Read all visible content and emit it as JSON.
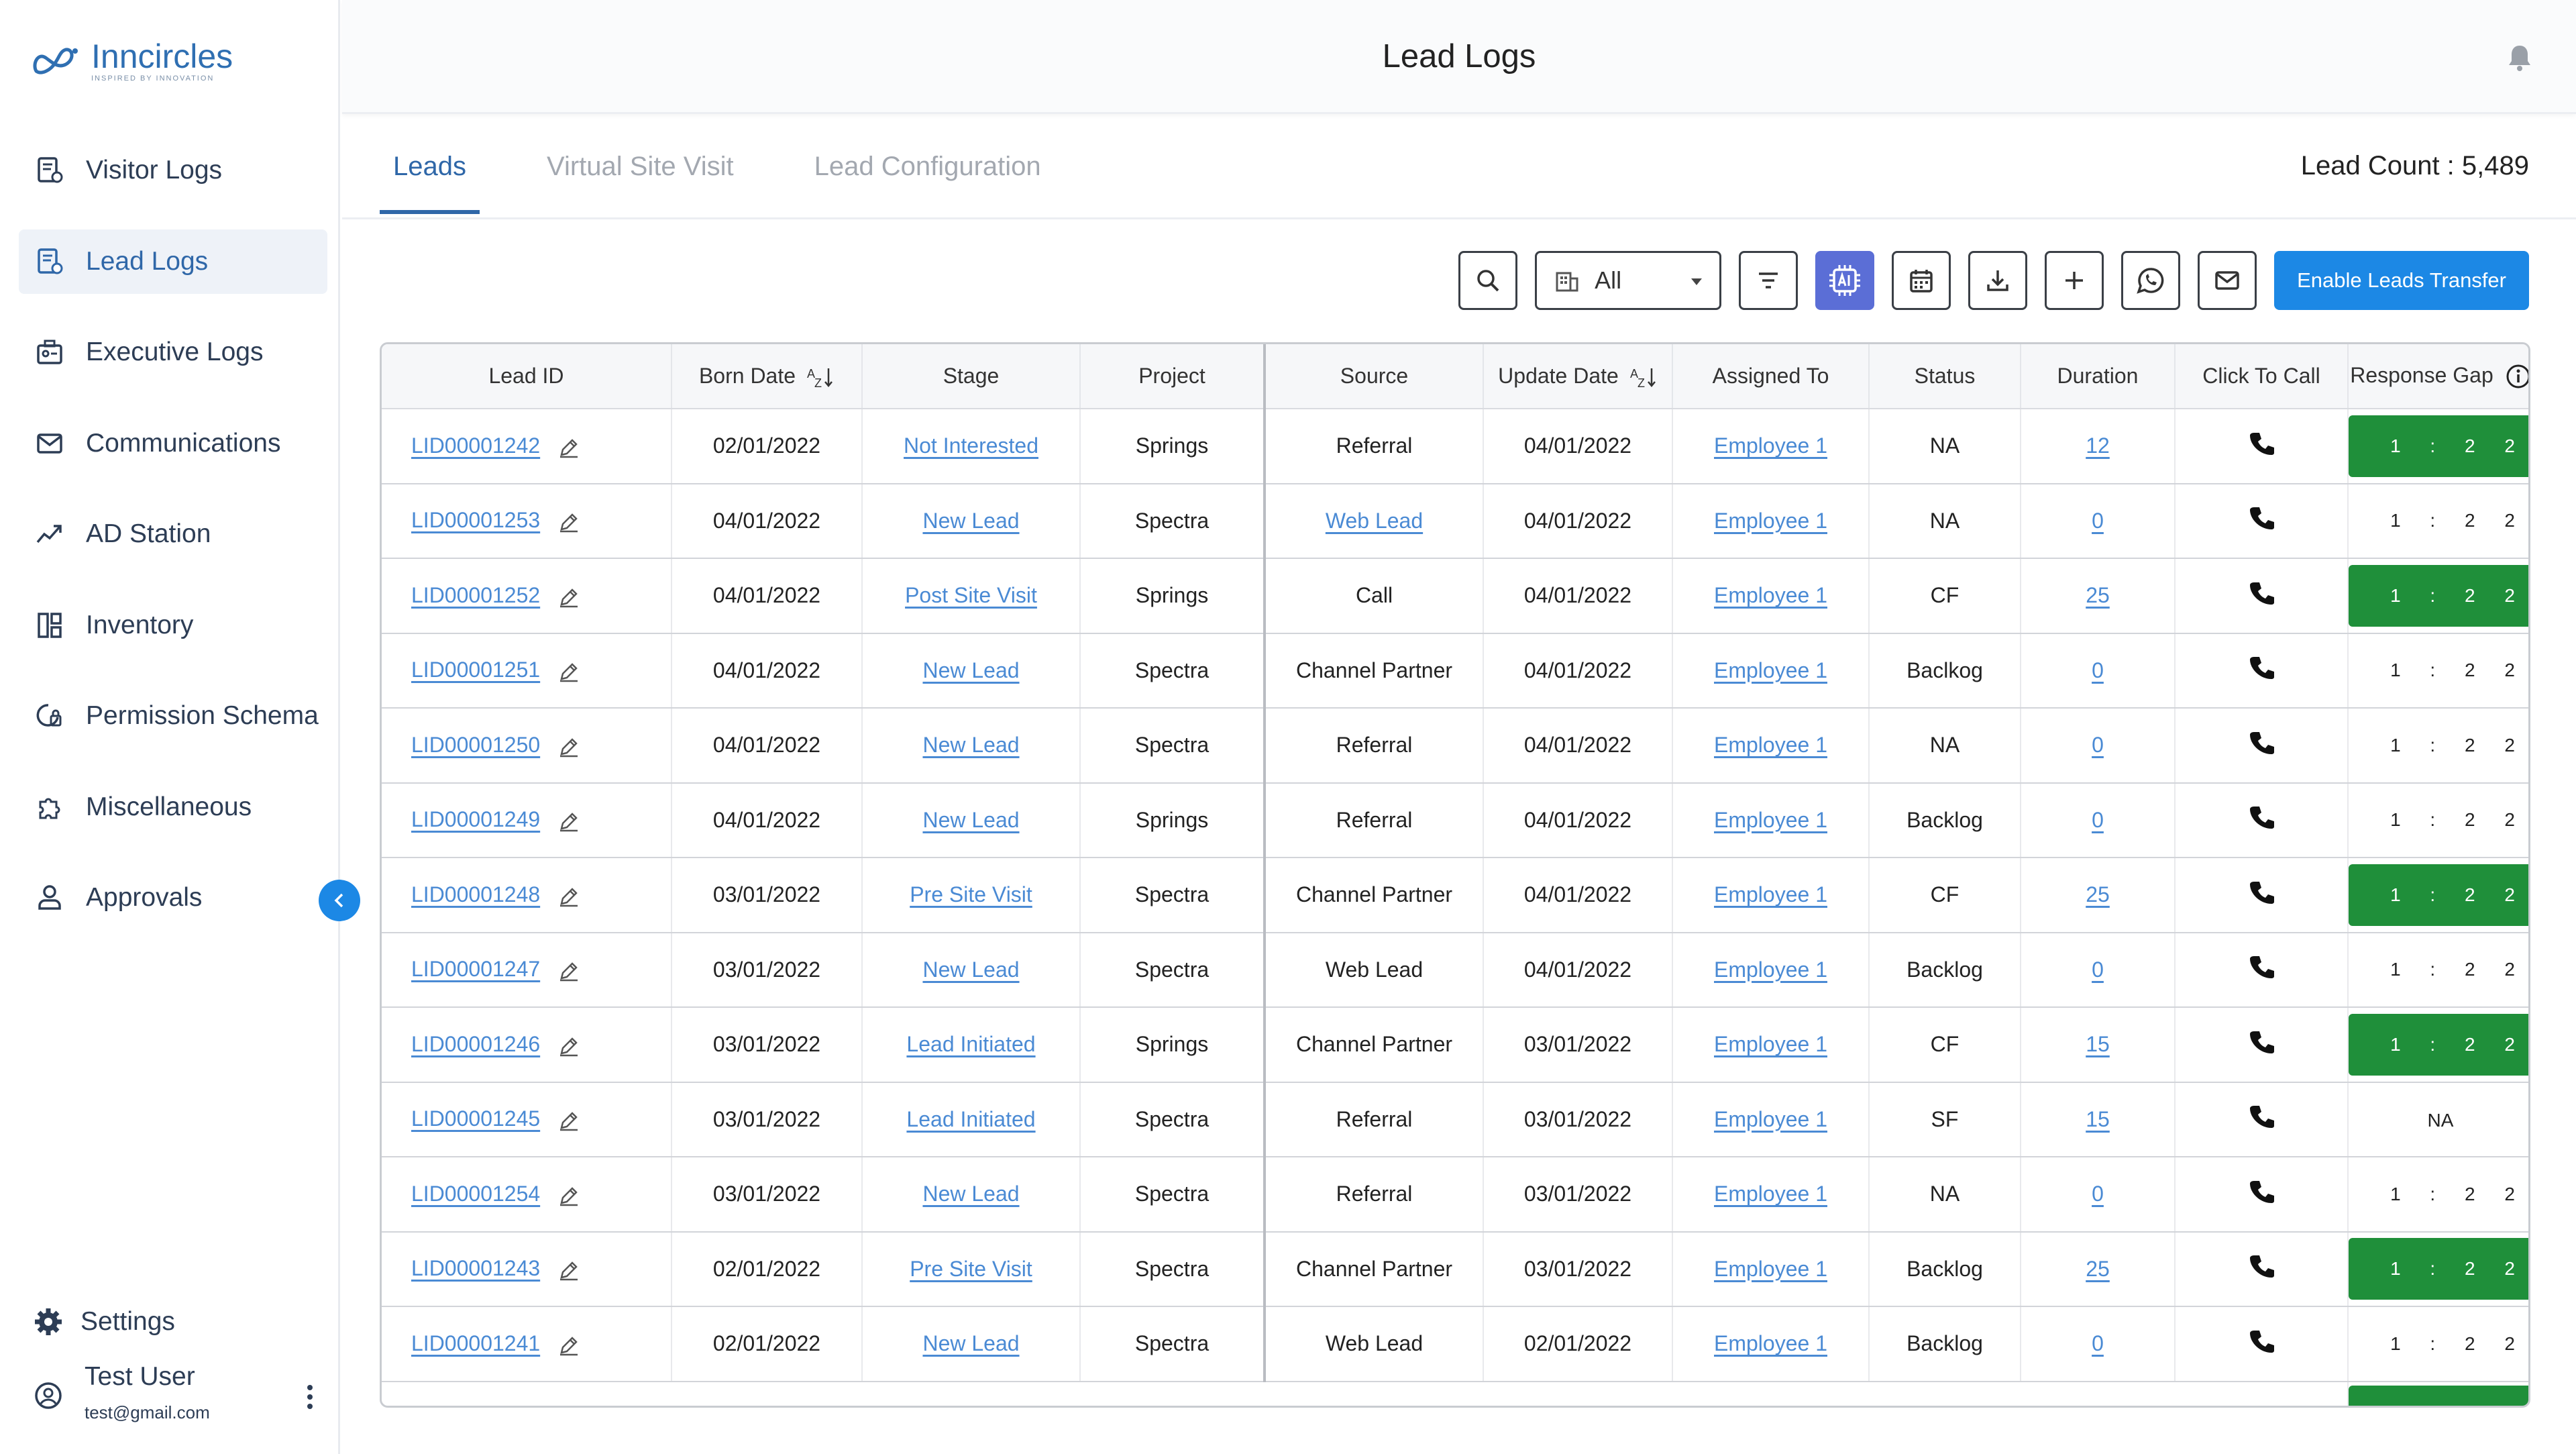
{
  "brand": {
    "name": "Inncircles",
    "tagline": "INSPIRED BY INNOVATION",
    "accent": "#2f67a8",
    "primary_button": "#1c88e5",
    "badge_green": "#1f8f3a"
  },
  "header": {
    "title": "Lead Logs",
    "bell_icon": "bell-icon"
  },
  "sidebar": {
    "items": [
      {
        "label": "Visitor Logs",
        "icon": "visitor-logs-icon"
      },
      {
        "label": "Lead Logs",
        "icon": "lead-logs-icon",
        "active": true
      },
      {
        "label": "Executive Logs",
        "icon": "executive-logs-icon"
      },
      {
        "label": "Communications",
        "icon": "mail-icon"
      },
      {
        "label": "AD Station",
        "icon": "trend-icon"
      },
      {
        "label": "Inventory",
        "icon": "inventory-icon"
      },
      {
        "label": "Permission Schema",
        "icon": "permission-icon"
      },
      {
        "label": "Miscellaneous",
        "icon": "puzzle-icon"
      },
      {
        "label": "Approvals",
        "icon": "person-icon"
      }
    ],
    "settings_label": "Settings",
    "user": {
      "name": "Test User",
      "email": "test@gmail.com"
    }
  },
  "tabs": [
    {
      "label": "Leads",
      "active": true
    },
    {
      "label": "Virtual Site Visit"
    },
    {
      "label": "Lead Configuration"
    }
  ],
  "lead_count": "Lead Count : 5,489",
  "toolbar": {
    "project_filter": "All",
    "enable_transfer_label": "Enable Leads Transfer"
  },
  "table": {
    "columns": [
      "Lead ID",
      "Born Date",
      "Stage",
      "Project",
      "Source",
      "Update Date",
      "Assigned To",
      "Status",
      "Duration",
      "Click To Call",
      "Response Gap"
    ],
    "rows": [
      {
        "id": "LID00001242",
        "born": "02/01/2022",
        "stage": "Not Interested",
        "project": "Springs",
        "source": "Referral",
        "source_link": false,
        "update": "04/01/2022",
        "assigned": "Employee 1",
        "status": "NA",
        "duration": "12",
        "gap": "1 : 2 2",
        "gap_green": true
      },
      {
        "id": "LID00001253",
        "born": "04/01/2022",
        "stage": "New Lead",
        "project": "Spectra",
        "source": "Web Lead",
        "source_link": true,
        "update": "04/01/2022",
        "assigned": "Employee 1",
        "status": "NA",
        "duration": "0",
        "gap": "1 : 2 2",
        "gap_green": false
      },
      {
        "id": "LID00001252",
        "born": "04/01/2022",
        "stage": "Post Site Visit",
        "project": "Springs",
        "source": "Call",
        "source_link": false,
        "update": "04/01/2022",
        "assigned": "Employee 1",
        "status": "CF",
        "duration": "25",
        "gap": "1 : 2 2",
        "gap_green": true
      },
      {
        "id": "LID00001251",
        "born": "04/01/2022",
        "stage": "New Lead",
        "project": "Spectra",
        "source": "Channel Partner",
        "source_link": false,
        "update": "04/01/2022",
        "assigned": "Employee 1",
        "status": "Baclkog",
        "duration": "0",
        "gap": "1 : 2 2",
        "gap_green": false
      },
      {
        "id": "LID00001250",
        "born": "04/01/2022",
        "stage": "New Lead",
        "project": "Spectra",
        "source": "Referral",
        "source_link": false,
        "update": "04/01/2022",
        "assigned": "Employee 1",
        "status": "NA",
        "duration": "0",
        "gap": "1 : 2 2",
        "gap_green": false
      },
      {
        "id": "LID00001249",
        "born": "04/01/2022",
        "stage": "New Lead",
        "project": "Springs",
        "source": "Referral",
        "source_link": false,
        "update": "04/01/2022",
        "assigned": "Employee 1",
        "status": "Backlog",
        "duration": "0",
        "gap": "1 : 2 2",
        "gap_green": false
      },
      {
        "id": "LID00001248",
        "born": "03/01/2022",
        "stage": "Pre Site Visit",
        "project": "Spectra",
        "source": "Channel Partner",
        "source_link": false,
        "update": "04/01/2022",
        "assigned": "Employee 1",
        "status": "CF",
        "duration": "25",
        "gap": "1 : 2 2",
        "gap_green": true
      },
      {
        "id": "LID00001247",
        "born": "03/01/2022",
        "stage": "New Lead",
        "project": "Spectra",
        "source": "Web Lead",
        "source_link": false,
        "update": "04/01/2022",
        "assigned": "Employee 1",
        "status": "Backlog",
        "duration": "0",
        "gap": "1 : 2 2",
        "gap_green": false
      },
      {
        "id": "LID00001246",
        "born": "03/01/2022",
        "stage": "Lead Initiated",
        "project": "Springs",
        "source": "Channel Partner",
        "source_link": false,
        "update": "03/01/2022",
        "assigned": "Employee 1",
        "status": "CF",
        "duration": "15",
        "gap": "1 : 2 2",
        "gap_green": true
      },
      {
        "id": "LID00001245",
        "born": "03/01/2022",
        "stage": "Lead Initiated",
        "project": "Spectra",
        "source": "Referral",
        "source_link": false,
        "update": "03/01/2022",
        "assigned": "Employee 1",
        "status": "SF",
        "duration": "15",
        "gap": "NA",
        "gap_green": false
      },
      {
        "id": "LID00001254",
        "born": "03/01/2022",
        "stage": "New Lead",
        "project": "Spectra",
        "source": "Referral",
        "source_link": false,
        "update": "03/01/2022",
        "assigned": "Employee 1",
        "status": "NA",
        "duration": "0",
        "gap": "1 : 2 2",
        "gap_green": false
      },
      {
        "id": "LID00001243",
        "born": "02/01/2022",
        "stage": "Pre Site Visit",
        "project": "Spectra",
        "source": "Channel Partner",
        "source_link": false,
        "update": "03/01/2022",
        "assigned": "Employee 1",
        "status": "Backlog",
        "duration": "25",
        "gap": "1 : 2 2",
        "gap_green": true
      },
      {
        "id": "LID00001241",
        "born": "02/01/2022",
        "stage": "New Lead",
        "project": "Spectra",
        "source": "Web Lead",
        "source_link": false,
        "update": "02/01/2022",
        "assigned": "Employee 1",
        "status": "Backlog",
        "duration": "0",
        "gap": "1 : 2 2",
        "gap_green": false
      }
    ]
  }
}
